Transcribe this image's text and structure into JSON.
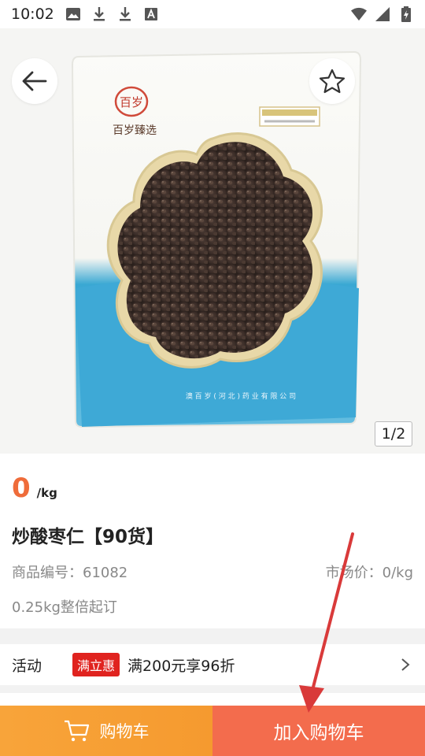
{
  "status_bar": {
    "time": "10:02",
    "left_icons": [
      "image-icon",
      "download-icon",
      "download-icon",
      "text-a-icon"
    ],
    "right_icons": [
      "wifi-icon",
      "signal-icon",
      "battery-charging-icon"
    ]
  },
  "hero": {
    "pager": "1/2",
    "product_image_text": {
      "brand": "百岁臻选",
      "manufacturer": "澳 百 岁 ( 河 北 ) 药 业 有 限 公 司"
    }
  },
  "product": {
    "price": "0",
    "unit": "/kg",
    "title": "炒酸枣仁【90货】",
    "code": "商品编号：61082",
    "market_price": "市场价：0/kg",
    "moq": "0.25kg整倍起订"
  },
  "promo": {
    "label": "活动",
    "badge": "满立惠",
    "text": "满200元享96折"
  },
  "bottom_bar": {
    "cart_label": "购物车",
    "add_to_cart_label": "加入购物车"
  },
  "colors": {
    "price": "#ef6c3a",
    "badge": "#e0231f",
    "cart_button": "#f8a43a",
    "add_button": "#f36c4d",
    "annotation_arrow": "#d93a3a"
  }
}
